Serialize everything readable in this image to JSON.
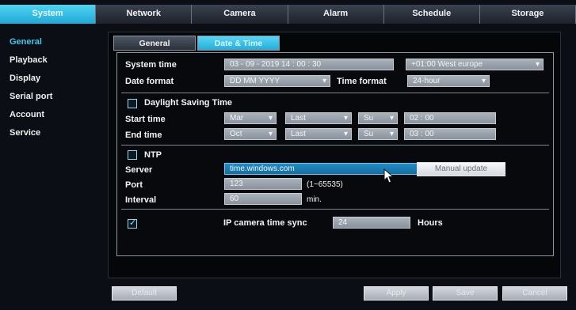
{
  "top_tabs": [
    "System",
    "Network",
    "Camera",
    "Alarm",
    "Schedule",
    "Storage"
  ],
  "left_nav": [
    "General",
    "Playback",
    "Display",
    "Serial port",
    "Account",
    "Service"
  ],
  "sub_tabs": [
    "General",
    "Date & Time"
  ],
  "datetime": {
    "system_time_label": "System time",
    "system_time_value": "03 - 09 - 2019    14 : 00 : 30",
    "timezone_value": "+01:00 West europe",
    "date_format_label": "Date format",
    "date_format_value": "DD MM YYYY",
    "time_format_label": "Time format",
    "time_format_value": "24-hour"
  },
  "dst": {
    "label": "Daylight Saving Time",
    "start_label": "Start time",
    "end_label": "End time",
    "start_month": "Mar",
    "start_week": "Last",
    "start_day": "Su",
    "start_time": "02 :  00",
    "end_month": "Oct",
    "end_week": "Last",
    "end_day": "Su",
    "end_time": "03 :  00"
  },
  "ntp": {
    "label": "NTP",
    "server_label": "Server",
    "server_value": "time.windows.com",
    "manual_update": "Manual update",
    "port_label": "Port",
    "port_value": "123",
    "port_range": "(1~65535)",
    "interval_label": "Interval",
    "interval_value": "60",
    "interval_unit": "min."
  },
  "ipc_sync": {
    "label": "IP camera time sync",
    "value": "24",
    "unit": "Hours"
  },
  "footer": {
    "default": "Default",
    "apply": "Apply",
    "save": "Save",
    "cancel": "Cancel"
  }
}
